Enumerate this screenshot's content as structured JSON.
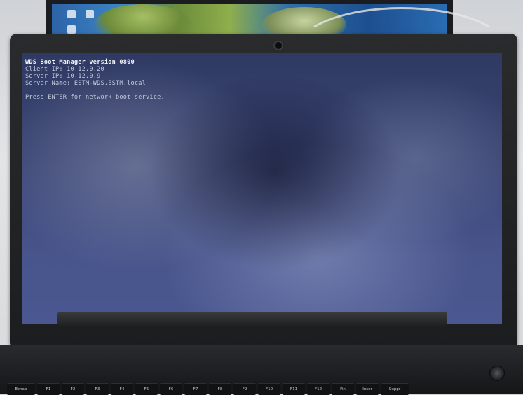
{
  "boot_screen": {
    "lines": [
      "WDS Boot Manager version 0800",
      "Client IP: 10.12.0.20",
      "Server IP: 10.12.0.9",
      "Server Name: ESTM-WDS.ESTM.local"
    ],
    "prompt": "Press ENTER for network boot service."
  },
  "keyboard": {
    "keys": [
      "Echap",
      "F1",
      "F2",
      "F3",
      "F4",
      "F5",
      "F6",
      "F7",
      "F8",
      "F9",
      "F10",
      "F11",
      "F12",
      "Fin",
      "Inser",
      "Suppr"
    ]
  },
  "colors": {
    "screen_bg": "#3a4575",
    "console_text": "#c3c9dd",
    "console_title": "#f2f4fb",
    "bezel": "#1c1d1f"
  }
}
